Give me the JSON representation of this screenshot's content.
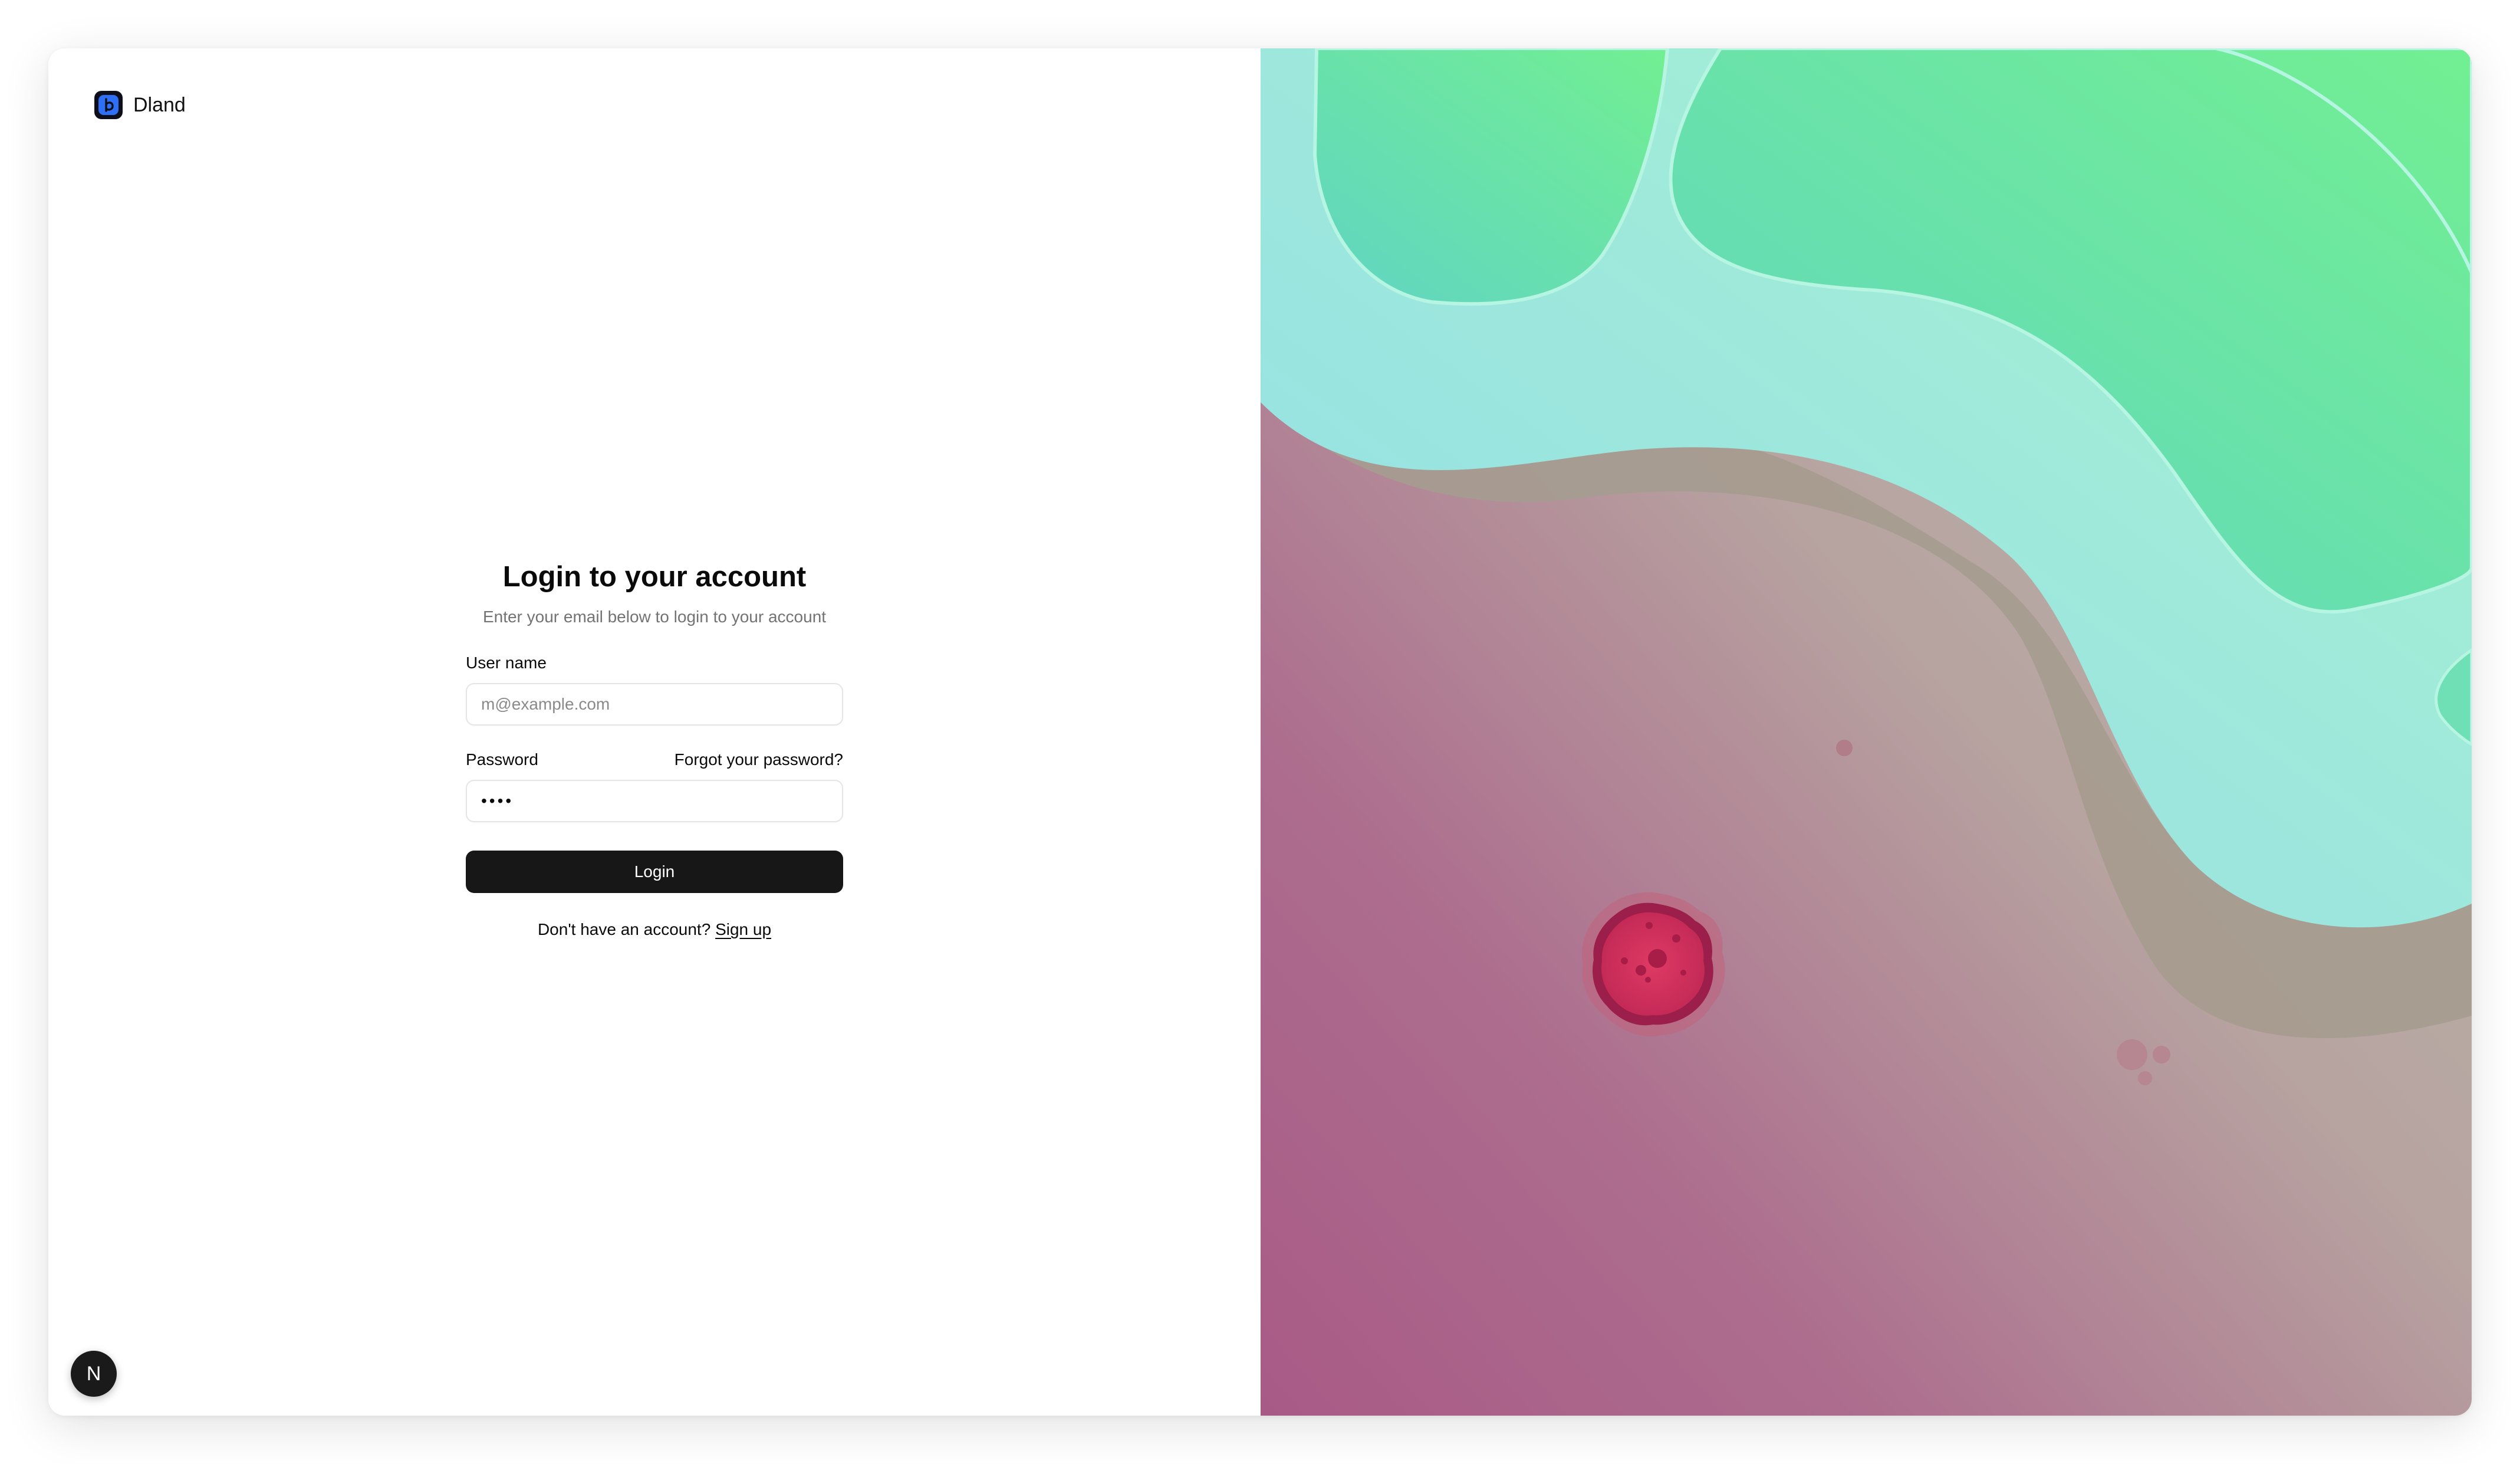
{
  "brand": {
    "name": "Dland",
    "logo_icon": "dland-logo-icon"
  },
  "login": {
    "title": "Login to your account",
    "subtitle": "Enter your email below to login to your account",
    "username_label": "User name",
    "username_placeholder": "m@example.com",
    "password_label": "Password",
    "password_value": "••••",
    "forgot_link": "Forgot your password?",
    "login_button": "Login",
    "signup_prompt": "Don't have an account?",
    "signup_link": "Sign up"
  },
  "dev_badge": {
    "label": "N",
    "icon": "nextjs-icon"
  },
  "illustration": {
    "description_icon": "terrain-illustration",
    "colors": {
      "water": "#9be3e4",
      "grass": "#6fe6a8",
      "rock": "#a89a8e",
      "ground_pink": "#ae6d8f",
      "ground_beige": "#b8b2a6",
      "cell": "#d9335f"
    }
  }
}
